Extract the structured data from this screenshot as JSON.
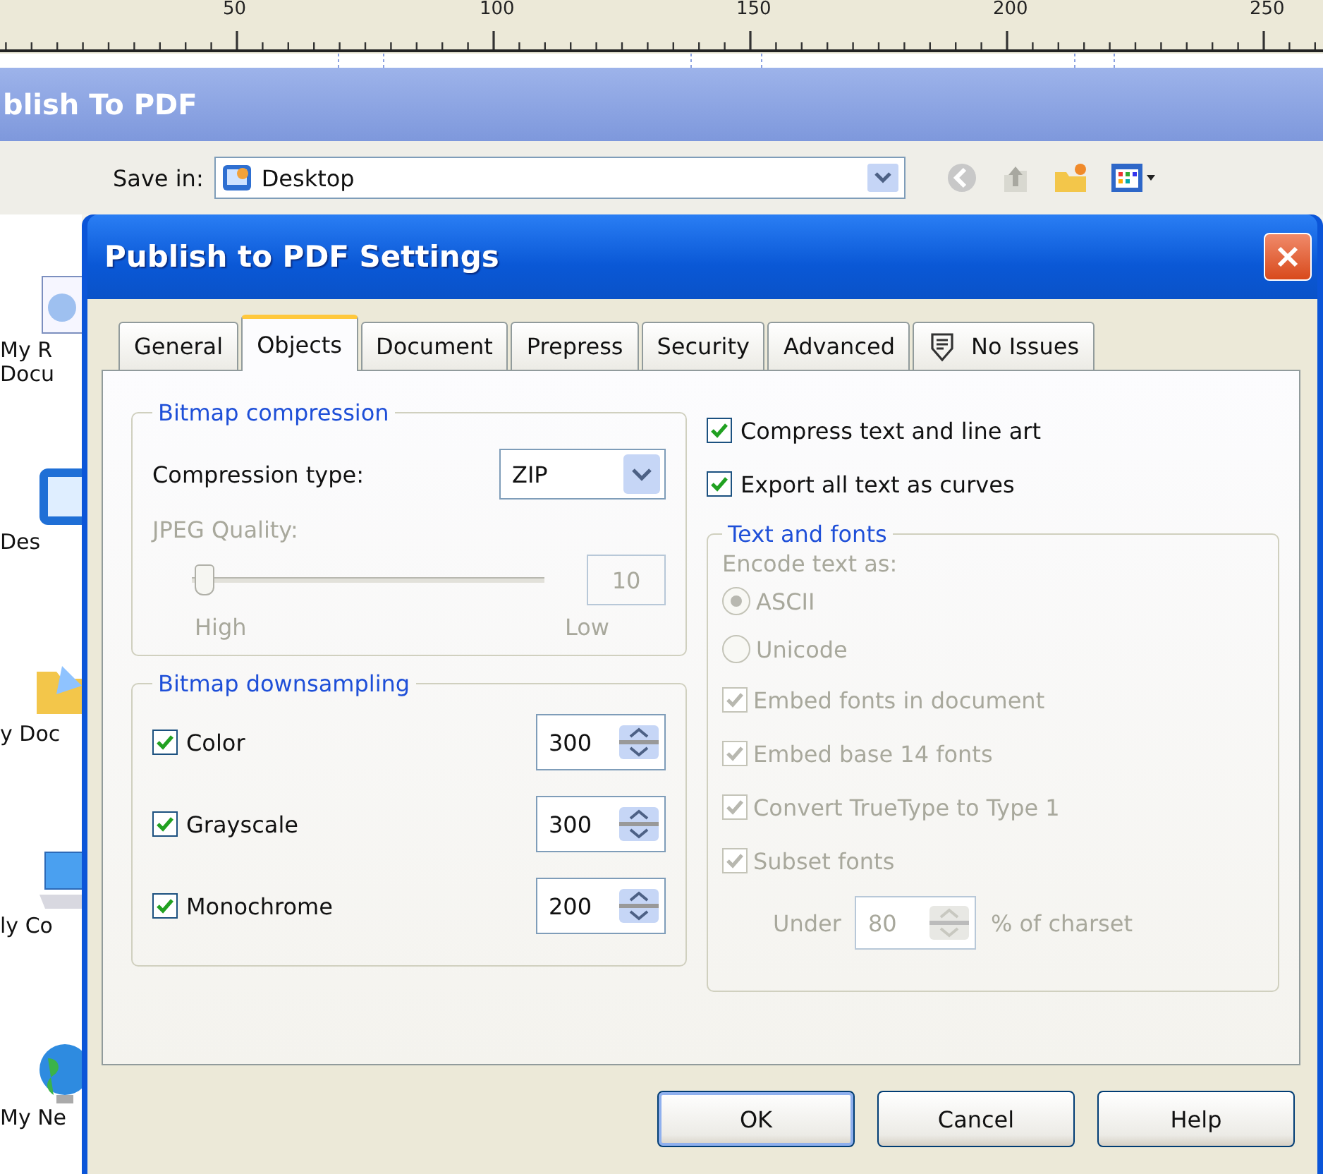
{
  "ruler": {
    "labels": [
      "50",
      "100",
      "150",
      "200",
      "250"
    ]
  },
  "background_window": {
    "title": "blish To PDF",
    "save_in": {
      "label": "Save in:",
      "value": "Desktop"
    },
    "places": [
      {
        "kind": "documents",
        "lines": [
          "My R",
          "Docu"
        ]
      },
      {
        "kind": "desktop",
        "lines": [
          "Des"
        ]
      },
      {
        "kind": "folder",
        "lines": [
          "y Doc"
        ]
      },
      {
        "kind": "computer",
        "lines": [
          "ly Co"
        ]
      },
      {
        "kind": "network",
        "lines": [
          "My Ne"
        ]
      }
    ]
  },
  "dialog": {
    "title": "Publish to PDF Settings",
    "tabs": [
      {
        "label": "General",
        "selected": false
      },
      {
        "label": "Objects",
        "selected": true
      },
      {
        "label": "Document",
        "selected": false
      },
      {
        "label": "Prepress",
        "selected": false
      },
      {
        "label": "Security",
        "selected": false
      },
      {
        "label": "Advanced",
        "selected": false
      },
      {
        "label": "No Issues",
        "selected": false,
        "kind": "issues"
      }
    ],
    "bitmap_compression": {
      "title": "Bitmap compression",
      "compression_type": {
        "label": "Compression type:",
        "value": "ZIP"
      },
      "jpeg_quality": {
        "label": "JPEG Quality:",
        "disabled": true,
        "level": 0.03,
        "value": "10",
        "min_label": "High",
        "max_label": "Low"
      }
    },
    "bitmap_downsampling": {
      "title": "Bitmap downsampling",
      "rows": [
        {
          "label": "Color",
          "checked": true,
          "value": "300"
        },
        {
          "label": "Grayscale",
          "checked": true,
          "value": "300"
        },
        {
          "label": "Monochrome",
          "checked": true,
          "value": "200"
        }
      ]
    },
    "options": [
      {
        "label": "Compress text and line art",
        "checked": true
      },
      {
        "label": "Export all text as curves",
        "checked": true
      }
    ],
    "text_and_fonts": {
      "title": "Text and fonts",
      "disabled": true,
      "encode_label": "Encode text as:",
      "encodings": [
        {
          "label": "ASCII",
          "selected": true
        },
        {
          "label": "Unicode",
          "selected": false
        }
      ],
      "font_options": [
        {
          "label": "Embed fonts in document",
          "checked": true
        },
        {
          "label": "Embed base 14 fonts",
          "checked": true
        },
        {
          "label": "Convert TrueType to Type 1",
          "checked": true
        },
        {
          "label": "Subset fonts",
          "checked": true
        }
      ],
      "subset_under": {
        "label": "Under",
        "value": "80",
        "suffix": "% of charset"
      }
    },
    "buttons": [
      {
        "label": "OK",
        "default": true
      },
      {
        "label": "Cancel",
        "default": false
      },
      {
        "label": "Help",
        "default": false
      }
    ]
  }
}
